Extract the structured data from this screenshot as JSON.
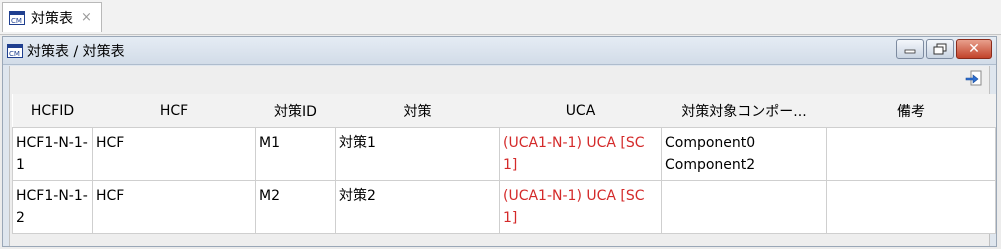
{
  "tab": {
    "label": "対策表",
    "close": "×"
  },
  "window": {
    "title": "対策表 / 対策表",
    "close": "✕"
  },
  "table": {
    "headers": [
      "HCFID",
      "HCF",
      "対策ID",
      "対策",
      "UCA",
      "対策対象コンポー...",
      "備考"
    ],
    "rows": [
      {
        "hcfid": "HCF1-N-1-1",
        "hcf": "HCF",
        "measure_id": "M1",
        "measure": "対策1",
        "uca": "(UCA1-N-1) UCA [SC1]",
        "targets": [
          "Component0",
          "Component2"
        ],
        "note": ""
      },
      {
        "hcfid": "HCF1-N-1-2",
        "hcf": "HCF",
        "measure_id": "M2",
        "measure": "対策2",
        "uca": "(UCA1-N-1) UCA [SC1]",
        "targets": [],
        "note": ""
      }
    ]
  },
  "colors": {
    "uca_text": "#d42a2a",
    "title_bg": "#dfe6ee",
    "close_btn": "#c2432b"
  },
  "icons": {
    "tab_icon": "cm-icon",
    "export": "export-arrow-icon"
  }
}
